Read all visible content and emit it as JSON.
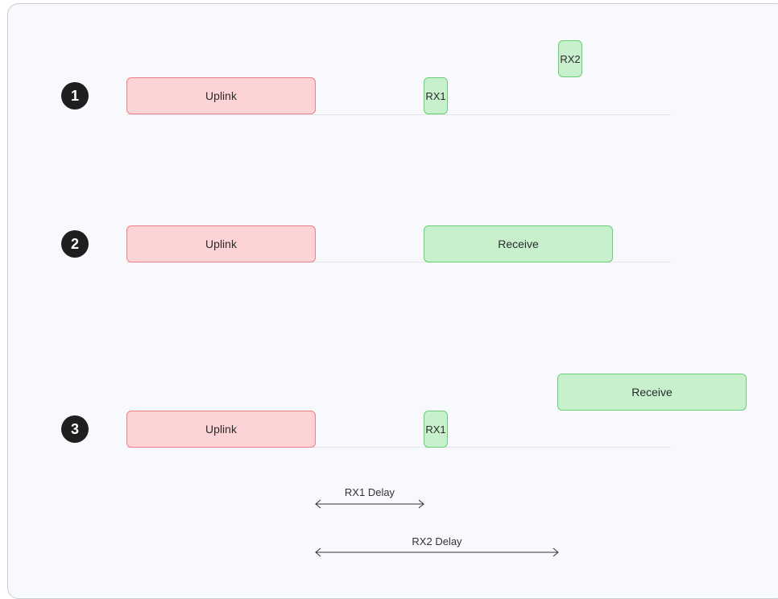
{
  "scenarios": [
    {
      "number": "1",
      "uplink": "Uplink",
      "rx1": "RX1",
      "rx2": "RX2"
    },
    {
      "number": "2",
      "uplink": "Uplink",
      "receive": "Receive"
    },
    {
      "number": "3",
      "uplink": "Uplink",
      "rx1": "RX1",
      "receive": "Receive"
    }
  ],
  "delays": {
    "rx1": "RX1 Delay",
    "rx2": "RX2 Delay"
  },
  "colors": {
    "uplink_fill": "#fdd4d6",
    "uplink_border": "#ef7e86",
    "receive_fill": "#c8f0cd",
    "receive_border": "#69cf76"
  }
}
